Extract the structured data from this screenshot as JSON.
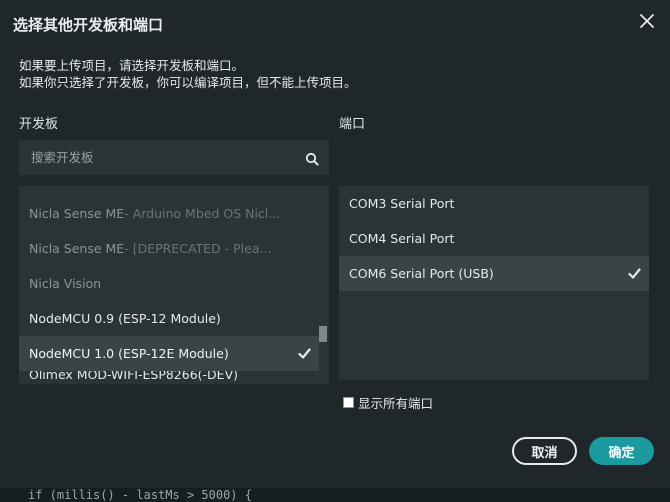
{
  "dialog": {
    "title": "选择其他开发板和端口",
    "description_line1": "如果要上传项目，请选择开发板和端口。",
    "description_line2": "如果你只选择了开发板，你可以编译项目，但不能上传项目。"
  },
  "boards": {
    "label": "开发板",
    "search_placeholder": "搜索开发板",
    "items": [
      {
        "name": "Nicla Sense ME",
        "extra": " - Arduino Mbed OS Nicl..."
      },
      {
        "name": "Nicla Sense ME",
        "extra": " - [DEPRECATED - Plea..."
      },
      {
        "name": "Nicla Vision",
        "extra": ""
      },
      {
        "name": "NodeMCU 0.9 (ESP-12 Module)",
        "extra": ""
      },
      {
        "name": "NodeMCU 1.0 (ESP-12E Module)",
        "extra": ""
      },
      {
        "name": "Olimex MOD-WIFI-ESP8266(-DEV)",
        "extra": ""
      }
    ],
    "selected_index": 4
  },
  "ports": {
    "label": "端口",
    "items": [
      "COM3 Serial Port",
      "COM4 Serial Port",
      "COM6 Serial Port (USB)"
    ],
    "selected_index": 2,
    "show_all_label": "显示所有端口",
    "show_all_checked": false
  },
  "buttons": {
    "cancel": "取消",
    "ok": "确定"
  },
  "background_code": "if (millis() - lastMs > 5000) {",
  "colors": {
    "dialog_bg": "#1f272a",
    "panel_bg": "#2a3336",
    "selected_bg": "#3a4447",
    "accent": "#1b9aa0"
  },
  "icons": [
    "close-icon",
    "search-icon",
    "check-icon"
  ]
}
